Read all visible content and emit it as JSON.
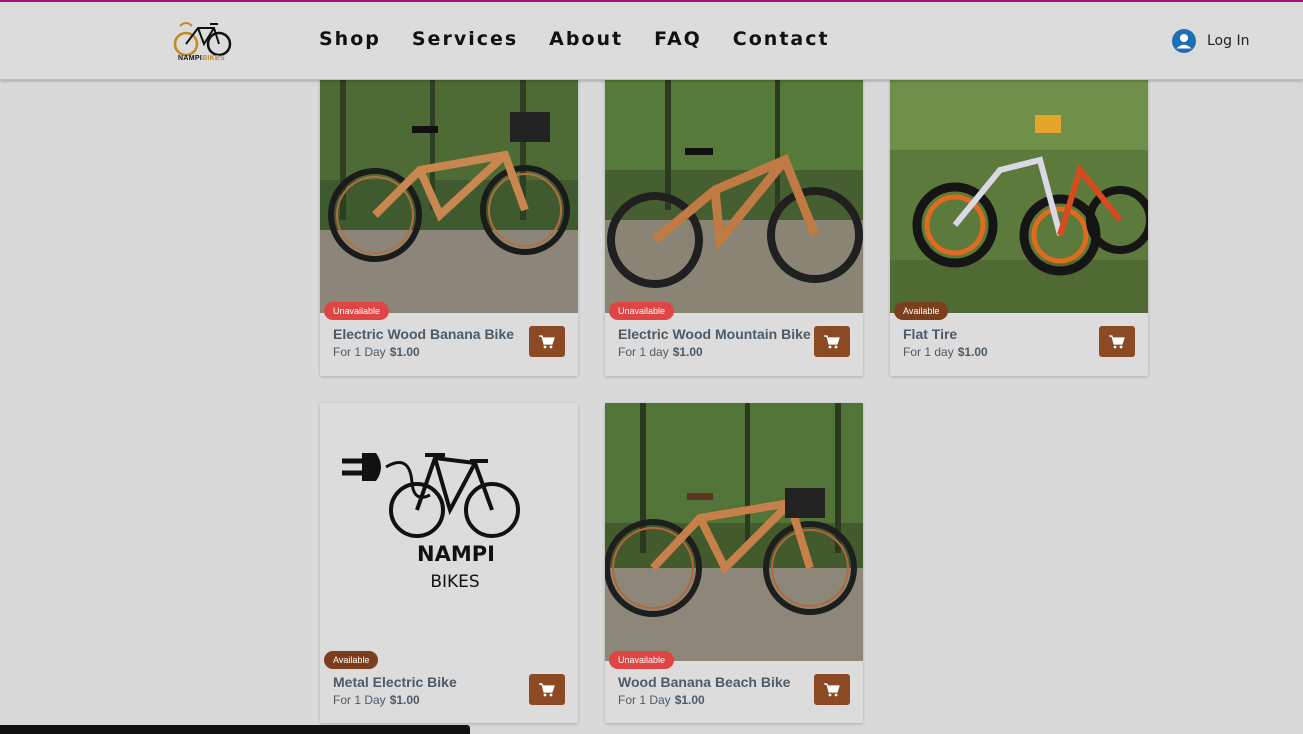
{
  "header": {
    "logo_text": "NAMPI",
    "logo_text_accent": "BIKES",
    "nav": [
      "Shop",
      "Services",
      "About",
      "FAQ",
      "Contact"
    ],
    "login_label": "Log In",
    "accent_color": "#a3107a"
  },
  "products": [
    {
      "name": "Electric Wood Banana Bike",
      "status": "Unavailable",
      "duration": "For 1 Day",
      "price": "$1.00"
    },
    {
      "name": "Electric Wood Mountain Bike",
      "status": "Unavailable",
      "duration": "For 1 day",
      "price": "$1.00"
    },
    {
      "name": "Flat Tire",
      "status": "Available",
      "duration": "For 1 day",
      "price": "$1.00"
    },
    {
      "name": "Metal Electric Bike",
      "status": "Available",
      "duration": "For 1 Day",
      "price": "$1.00",
      "image_text_1": "NAMPI",
      "image_text_2": "BIKES"
    },
    {
      "name": "Wood Banana Beach Bike",
      "status": "Unavailable",
      "duration": "For 1 Day",
      "price": "$1.00"
    }
  ],
  "colors": {
    "unavailable_badge": "#e04545",
    "available_badge": "#7b3f1e",
    "cart_button": "#8b4a23"
  },
  "icons": {
    "cart": "shopping-cart-icon",
    "user": "user-avatar-icon"
  }
}
